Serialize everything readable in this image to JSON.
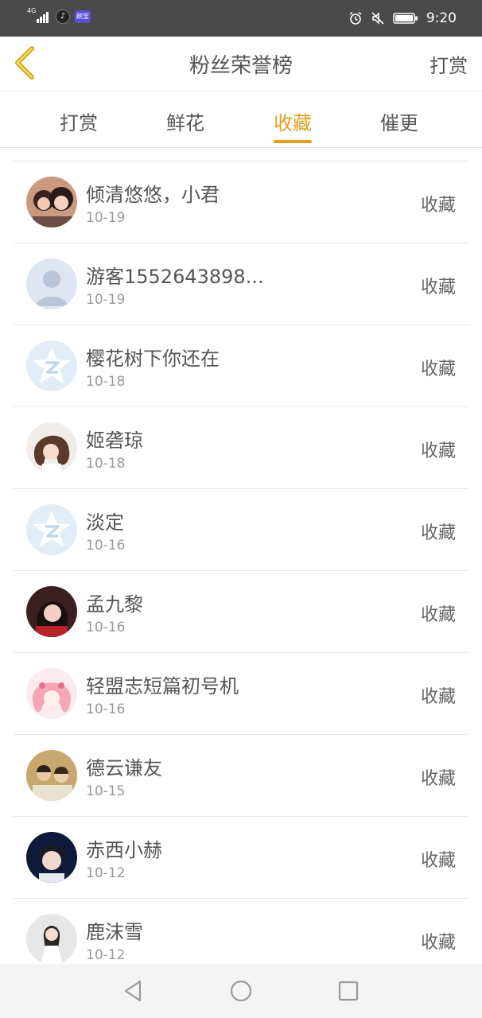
{
  "statusbar": {
    "network": "4G",
    "app_badge": "刷宝",
    "time": "9:20"
  },
  "header": {
    "title": "粉丝荣誉榜",
    "action_label": "打赏"
  },
  "tabs": [
    {
      "label": "打赏"
    },
    {
      "label": "鲜花"
    },
    {
      "label": "收藏"
    },
    {
      "label": "催更"
    }
  ],
  "active_tab": "收藏",
  "list": [
    {
      "name": "倾清悠悠，小君",
      "date": "10-19",
      "type": "收藏",
      "avatar": "photo-two-girls"
    },
    {
      "name": "游客1552643898...",
      "date": "10-19",
      "type": "收藏",
      "avatar": "default-person-icon"
    },
    {
      "name": "樱花树下你还在",
      "date": "10-18",
      "type": "收藏",
      "avatar": "qq-zone-icon"
    },
    {
      "name": "姬砻琼",
      "date": "10-18",
      "type": "收藏",
      "avatar": "photo-girl-brown-hair"
    },
    {
      "name": "淡定",
      "date": "10-16",
      "type": "收藏",
      "avatar": "qq-zone-icon"
    },
    {
      "name": "孟九黎",
      "date": "10-16",
      "type": "收藏",
      "avatar": "photo-girl-red"
    },
    {
      "name": "轻盟志短篇初号机",
      "date": "10-16",
      "type": "收藏",
      "avatar": "anime-girl-pink"
    },
    {
      "name": "德云谦友",
      "date": "10-15",
      "type": "收藏",
      "avatar": "photo-two-men"
    },
    {
      "name": "赤西小赫",
      "date": "10-12",
      "type": "收藏",
      "avatar": "photo-boy-dark"
    },
    {
      "name": "鹿沫雪",
      "date": "10-12",
      "type": "收藏",
      "avatar": "photo-girl-white"
    }
  ],
  "colors": {
    "accent": "#e0a020",
    "statusbar": "#4a4a4a",
    "divider": "#e6e6e6"
  }
}
